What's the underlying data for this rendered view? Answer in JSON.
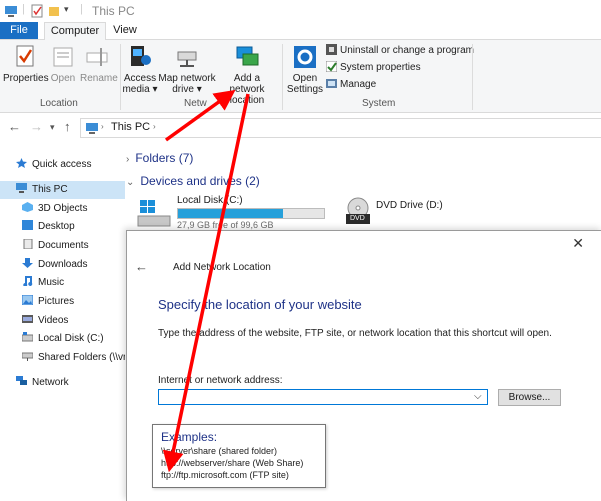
{
  "window": {
    "title": "This PC"
  },
  "tabs": {
    "file": "File",
    "computer": "Computer",
    "view": "View"
  },
  "ribbon": {
    "location": {
      "label": "Location",
      "properties": "Properties",
      "open": "Open",
      "rename": "Rename"
    },
    "network": {
      "label": "Netw",
      "access_media": "Access media",
      "map_network_drive": "Map network drive",
      "add_network_location": "Add a network location"
    },
    "system": {
      "label": "System",
      "open_settings": "Open Settings",
      "uninstall": "Uninstall or change a program",
      "system_properties": "System properties",
      "manage": "Manage"
    }
  },
  "address": {
    "path": "This PC"
  },
  "nav": {
    "quick_access": "Quick access",
    "this_pc": "This PC",
    "items": [
      "3D Objects",
      "Desktop",
      "Documents",
      "Downloads",
      "Music",
      "Pictures",
      "Videos",
      "Local Disk (C:)",
      "Shared Folders (\\\\vr"
    ],
    "network": "Network"
  },
  "content": {
    "folders": "Folders (7)",
    "devices": "Devices and drives (2)",
    "disk_c_name": "Local Disk (C:)",
    "disk_c_free": "27,9 GB free of 99,6 GB",
    "disk_c_used_fraction": 0.72,
    "dvd_name": "DVD Drive (D:)",
    "dvd_badge": "DVD"
  },
  "dialog": {
    "title": "Add Network Location",
    "heading": "Specify the location of your website",
    "description": "Type the address of the website, FTP site, or network location that this shortcut will open.",
    "address_label": "Internet or network address:",
    "address_value": "",
    "browse": "Browse...",
    "examples_heading": "Examples:",
    "examples": [
      "\\\\server\\share   (shared folder)",
      "http://webserver/share   (Web Share)",
      "ftp://ftp.microsoft.com   (FTP site)"
    ]
  },
  "colors": {
    "accent": "#1a6fc4",
    "annotation": "#ff0000",
    "link": "#1e3287"
  }
}
